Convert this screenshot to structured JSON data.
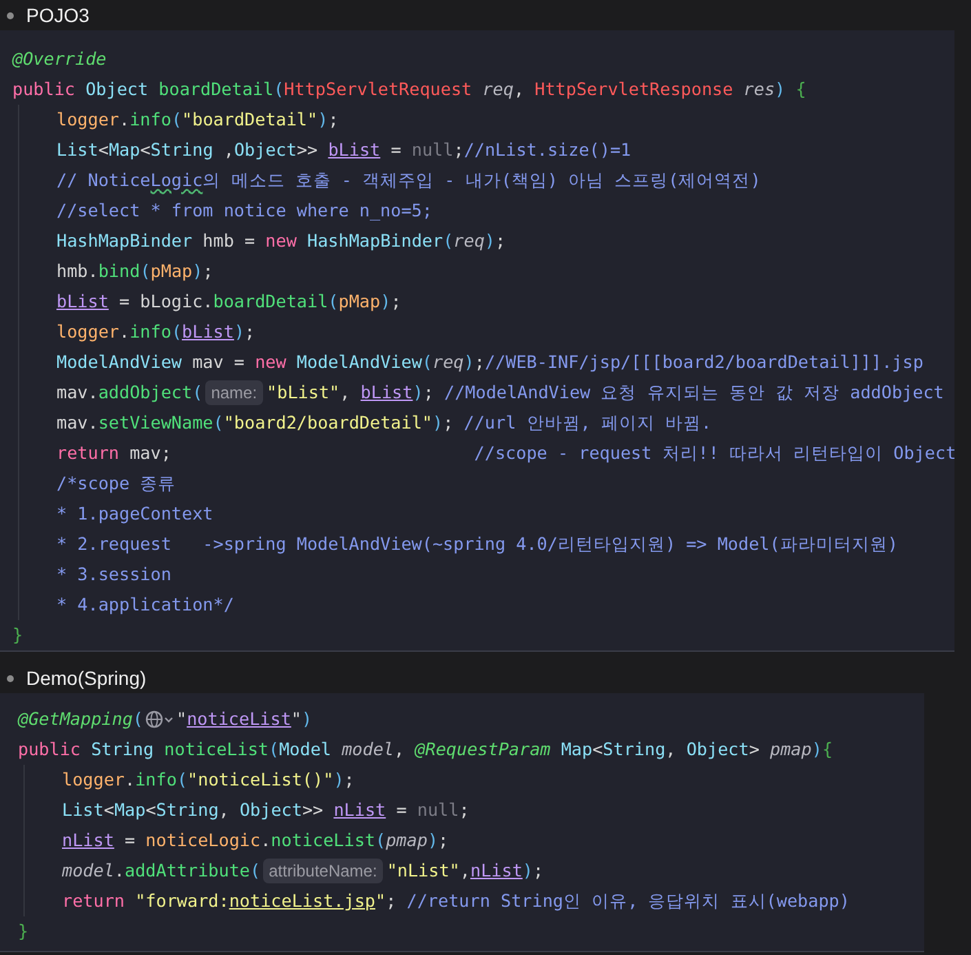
{
  "panels": [
    {
      "title": "POJO3",
      "before": [
        [
          {
            "kind": "ann",
            "text": "@Override"
          }
        ],
        [
          {
            "kind": "kw",
            "text": "public "
          },
          {
            "kind": "type",
            "text": "Object "
          },
          {
            "kind": "fn",
            "text": "boardDetail"
          },
          {
            "kind": "paren",
            "text": "("
          },
          {
            "kind": "cls",
            "text": "HttpServletRequest "
          },
          {
            "kind": "param",
            "text": "req"
          },
          {
            "kind": "plain",
            "text": ", "
          },
          {
            "kind": "cls",
            "text": "HttpServletResponse "
          },
          {
            "kind": "param",
            "text": "res"
          },
          {
            "kind": "paren",
            "text": ") "
          },
          {
            "kind": "brace",
            "text": "{"
          }
        ]
      ],
      "body": [
        [
          {
            "kind": "obj",
            "text": "logger"
          },
          {
            "kind": "plain",
            "text": "."
          },
          {
            "kind": "fn",
            "text": "info"
          },
          {
            "kind": "paren",
            "text": "("
          },
          {
            "kind": "str",
            "text": "\"boardDetail\""
          },
          {
            "kind": "paren",
            "text": ")"
          },
          {
            "kind": "plain",
            "text": ";"
          }
        ],
        [
          {
            "kind": "type",
            "text": "List"
          },
          {
            "kind": "plain",
            "text": "<"
          },
          {
            "kind": "type",
            "text": "Map"
          },
          {
            "kind": "plain",
            "text": "<"
          },
          {
            "kind": "type",
            "text": "String"
          },
          {
            "kind": "plain",
            "text": " ,"
          },
          {
            "kind": "type",
            "text": "Object"
          },
          {
            "kind": "plain",
            "text": ">> "
          },
          {
            "kind": "var",
            "text": "bList"
          },
          {
            "kind": "plain",
            "text": " = "
          },
          {
            "kind": "null",
            "text": "null"
          },
          {
            "kind": "plain",
            "text": ";"
          },
          {
            "kind": "cmt",
            "text": "//nList.size()=1"
          }
        ],
        [
          {
            "kind": "cmt",
            "text": "// Notice"
          },
          {
            "kind": "typo",
            "text": "Logic"
          },
          {
            "kind": "cmt",
            "text": "의 메소드 호출 - 객체주입 - 내가(책임) 아님 스프링(제어역전)"
          }
        ],
        [
          {
            "kind": "cmt",
            "text": "//select * from notice where n_no=5;"
          }
        ],
        [
          {
            "kind": "type",
            "text": "HashMapBinder"
          },
          {
            "kind": "plain",
            "text": " hmb = "
          },
          {
            "kind": "kw",
            "text": "new "
          },
          {
            "kind": "type",
            "text": "HashMapBinder"
          },
          {
            "kind": "paren",
            "text": "("
          },
          {
            "kind": "param",
            "text": "req"
          },
          {
            "kind": "paren",
            "text": ")"
          },
          {
            "kind": "plain",
            "text": ";"
          }
        ],
        [
          {
            "kind": "plain",
            "text": "hmb."
          },
          {
            "kind": "fn",
            "text": "bind"
          },
          {
            "kind": "paren",
            "text": "("
          },
          {
            "kind": "obj",
            "text": "pMap"
          },
          {
            "kind": "paren",
            "text": ")"
          },
          {
            "kind": "plain",
            "text": ";"
          }
        ],
        [
          {
            "kind": "var",
            "text": "bList"
          },
          {
            "kind": "plain",
            "text": " = bLogic."
          },
          {
            "kind": "fn",
            "text": "boardDetail"
          },
          {
            "kind": "paren",
            "text": "("
          },
          {
            "kind": "obj",
            "text": "pMap"
          },
          {
            "kind": "paren",
            "text": ")"
          },
          {
            "kind": "plain",
            "text": ";"
          }
        ],
        [
          {
            "kind": "obj",
            "text": "logger"
          },
          {
            "kind": "plain",
            "text": "."
          },
          {
            "kind": "fn",
            "text": "info"
          },
          {
            "kind": "paren",
            "text": "("
          },
          {
            "kind": "var",
            "text": "bList"
          },
          {
            "kind": "paren",
            "text": ")"
          },
          {
            "kind": "plain",
            "text": ";"
          }
        ],
        [
          {
            "kind": "type",
            "text": "ModelAndView"
          },
          {
            "kind": "plain",
            "text": " mav = "
          },
          {
            "kind": "kw",
            "text": "new "
          },
          {
            "kind": "type",
            "text": "ModelAndView"
          },
          {
            "kind": "paren",
            "text": "("
          },
          {
            "kind": "param",
            "text": "req"
          },
          {
            "kind": "paren",
            "text": ")"
          },
          {
            "kind": "plain",
            "text": ";"
          },
          {
            "kind": "cmt",
            "text": "//WEB-INF/jsp/[[[board2/boardDetail]]].jsp"
          }
        ],
        [
          {
            "kind": "plain",
            "text": "mav."
          },
          {
            "kind": "fn",
            "text": "addObject"
          },
          {
            "kind": "paren",
            "text": "("
          },
          {
            "kind": "hint",
            "text": "name:"
          },
          {
            "kind": "str",
            "text": "\"bList\""
          },
          {
            "kind": "plain",
            "text": ", "
          },
          {
            "kind": "var",
            "text": "bList"
          },
          {
            "kind": "paren",
            "text": ")"
          },
          {
            "kind": "plain",
            "text": "; "
          },
          {
            "kind": "cmt",
            "text": "//ModelAndView 요청 유지되는 동안 값 저장 addObject"
          }
        ],
        [
          {
            "kind": "plain",
            "text": "mav."
          },
          {
            "kind": "fn",
            "text": "setViewName"
          },
          {
            "kind": "paren",
            "text": "("
          },
          {
            "kind": "str",
            "text": "\"board2/boardDetail\""
          },
          {
            "kind": "paren",
            "text": ")"
          },
          {
            "kind": "plain",
            "text": "; "
          },
          {
            "kind": "cmt",
            "text": "//url 안바뀜, 페이지 바뀜."
          }
        ],
        [
          {
            "kind": "kw",
            "text": "return"
          },
          {
            "kind": "plain",
            "text": " mav;                             "
          },
          {
            "kind": "cmt",
            "text": "//scope - request 처리!! 따라서 리턴타입이 Object"
          }
        ],
        [
          {
            "kind": "cmt",
            "text": "/*scope 종류"
          }
        ],
        [
          {
            "kind": "cmt",
            "text": "* 1.pageContext"
          }
        ],
        [
          {
            "kind": "cmt",
            "text": "* 2.request   ->spring ModelAndView(~spring 4.0/리턴타입지원) => Model(파라미터지원)"
          }
        ],
        [
          {
            "kind": "cmt",
            "text": "* 3.session"
          }
        ],
        [
          {
            "kind": "cmt",
            "text": "* 4.application*/"
          }
        ]
      ],
      "after": [
        [
          {
            "kind": "brace",
            "text": "}"
          }
        ]
      ]
    },
    {
      "title": "Demo(Spring)",
      "before": [
        [
          {
            "kind": "ann",
            "text": "@GetMapping"
          },
          {
            "kind": "paren",
            "text": "("
          },
          {
            "kind": "icon"
          },
          {
            "kind": "plain",
            "text": "\""
          },
          {
            "kind": "var",
            "text": "noticeList"
          },
          {
            "kind": "plain",
            "text": "\""
          },
          {
            "kind": "paren",
            "text": ")"
          }
        ],
        [
          {
            "kind": "kw",
            "text": "public "
          },
          {
            "kind": "type",
            "text": "String "
          },
          {
            "kind": "fn",
            "text": "noticeList"
          },
          {
            "kind": "paren",
            "text": "("
          },
          {
            "kind": "type",
            "text": "Model "
          },
          {
            "kind": "param",
            "text": "model"
          },
          {
            "kind": "plain",
            "text": ", "
          },
          {
            "kind": "ann",
            "text": "@RequestParam "
          },
          {
            "kind": "type",
            "text": "Map"
          },
          {
            "kind": "plain",
            "text": "<"
          },
          {
            "kind": "type",
            "text": "String"
          },
          {
            "kind": "plain",
            "text": ", "
          },
          {
            "kind": "type",
            "text": "Object"
          },
          {
            "kind": "plain",
            "text": "> "
          },
          {
            "kind": "param",
            "text": "pmap"
          },
          {
            "kind": "paren",
            "text": ")"
          },
          {
            "kind": "brace",
            "text": "{"
          }
        ]
      ],
      "body": [
        [
          {
            "kind": "obj",
            "text": "logger"
          },
          {
            "kind": "plain",
            "text": "."
          },
          {
            "kind": "fn",
            "text": "info"
          },
          {
            "kind": "paren",
            "text": "("
          },
          {
            "kind": "str",
            "text": "\"noticeList()\""
          },
          {
            "kind": "paren",
            "text": ")"
          },
          {
            "kind": "plain",
            "text": ";"
          }
        ],
        [
          {
            "kind": "type",
            "text": "List"
          },
          {
            "kind": "plain",
            "text": "<"
          },
          {
            "kind": "type",
            "text": "Map"
          },
          {
            "kind": "plain",
            "text": "<"
          },
          {
            "kind": "type",
            "text": "String"
          },
          {
            "kind": "plain",
            "text": ", "
          },
          {
            "kind": "type",
            "text": "Object"
          },
          {
            "kind": "plain",
            "text": ">> "
          },
          {
            "kind": "var",
            "text": "nList"
          },
          {
            "kind": "plain",
            "text": " = "
          },
          {
            "kind": "null",
            "text": "null"
          },
          {
            "kind": "plain",
            "text": ";"
          }
        ],
        [
          {
            "kind": "var",
            "text": "nList"
          },
          {
            "kind": "plain",
            "text": " = "
          },
          {
            "kind": "obj",
            "text": "noticeLogic"
          },
          {
            "kind": "plain",
            "text": "."
          },
          {
            "kind": "fn",
            "text": "noticeList"
          },
          {
            "kind": "paren",
            "text": "("
          },
          {
            "kind": "param",
            "text": "pmap"
          },
          {
            "kind": "paren",
            "text": ")"
          },
          {
            "kind": "plain",
            "text": ";"
          }
        ],
        [
          {
            "kind": "param",
            "text": "model"
          },
          {
            "kind": "plain",
            "text": "."
          },
          {
            "kind": "fn",
            "text": "addAttribute"
          },
          {
            "kind": "paren",
            "text": "("
          },
          {
            "kind": "hint",
            "text": "attributeName:"
          },
          {
            "kind": "str",
            "text": "\"nList\""
          },
          {
            "kind": "plain",
            "text": ","
          },
          {
            "kind": "var",
            "text": "nList"
          },
          {
            "kind": "paren",
            "text": ")"
          },
          {
            "kind": "plain",
            "text": ";"
          }
        ],
        [
          {
            "kind": "kw",
            "text": "return "
          },
          {
            "kind": "str",
            "text": "\"forward:"
          },
          {
            "kind": "strlink",
            "text": "noticeList.jsp"
          },
          {
            "kind": "str",
            "text": "\""
          },
          {
            "kind": "plain",
            "text": "; "
          },
          {
            "kind": "cmt",
            "text": "//return String인 이유, 응답위치 표시(webapp)"
          }
        ]
      ],
      "after": [
        [
          {
            "kind": "brace",
            "text": "}"
          }
        ]
      ]
    }
  ]
}
